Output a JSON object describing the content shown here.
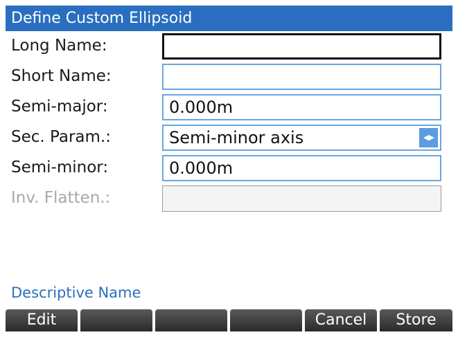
{
  "title": "Define Custom Ellipsoid",
  "fields": {
    "long_name": {
      "label": "Long Name:",
      "value": ""
    },
    "short_name": {
      "label": "Short Name:",
      "value": ""
    },
    "semi_major": {
      "label": "Semi-major:",
      "value": "0.000m"
    },
    "sec_param": {
      "label": "Sec. Param.:",
      "value": "Semi-minor axis"
    },
    "semi_minor": {
      "label": "Semi-minor:",
      "value": "0.000m"
    },
    "inv_flatten": {
      "label": "Inv. Flatten.:",
      "value": ""
    }
  },
  "help_text": "Descriptive Name",
  "menu": {
    "key1": "Edit",
    "key2": "",
    "key3": "",
    "key4": "",
    "key5": "Cancel",
    "key6": "Store"
  },
  "colors": {
    "title_bar": "#2a6fbf",
    "field_border": "#6aa6e0",
    "menu_key": "#3a3a3a",
    "help_text": "#2a6fbf"
  },
  "icons": {
    "choose_arrow": "left-right-arrow-icon"
  }
}
